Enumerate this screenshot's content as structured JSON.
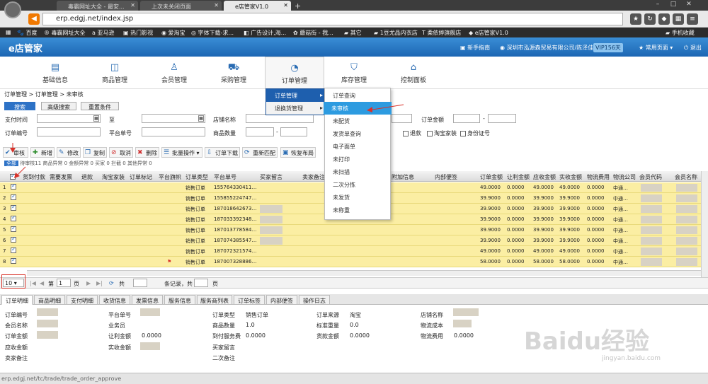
{
  "browser": {
    "tabs": [
      "毒霸网址大全 - 最安...",
      "上次未关闭页面",
      "e店管家V1.0"
    ],
    "new_tab": "+",
    "url": "erp.edgj.net/index.jsp"
  },
  "bookmarks": [
    "百度",
    "毒霸网址大全",
    "亚马逊",
    "热门影视",
    "爱淘宝",
    "字体下载-求...",
    "广告设计,海...",
    "蘑菇街 - 我...",
    "其它",
    "1豆尤品内衣店",
    "柔依婷旗舰店",
    "e店管家V1.0",
    "手机收藏"
  ],
  "app": {
    "logo": "e店管家",
    "header_links": [
      "新手指南",
      "深圳市泓源森贸易有限公司/陈泽佳",
      "VIP156天",
      "常用页面",
      "退出"
    ]
  },
  "menu": [
    {
      "label": "基础信息",
      "icon": "info-icon"
    },
    {
      "label": "商品管理",
      "icon": "bag-icon"
    },
    {
      "label": "会员管理",
      "icon": "user-icon"
    },
    {
      "label": "采购管理",
      "icon": "truck-icon"
    },
    {
      "label": "订单管理",
      "icon": "pie-icon"
    },
    {
      "label": "库存管理",
      "icon": "cart-icon"
    },
    {
      "label": "控制面板",
      "icon": "home-icon"
    }
  ],
  "breadcrumb": "订单管理 > 订单管理 > 未审核",
  "search_tabs": [
    "搜索",
    "高级搜索",
    "重置条件"
  ],
  "filters": {
    "pay_time": "支付时间",
    "to": "至",
    "shop_name": "店铺名称",
    "order_amount": "订单金额",
    "order_no": "订单编号",
    "platform_no": "平台单号",
    "goods_qty": "商品数量",
    "dash": "-",
    "cb_labels": [
      "退款",
      "淘宝家装",
      "身份证号"
    ]
  },
  "toolbar": [
    "审核",
    "新增",
    "修改",
    "复制",
    "取消",
    "删除",
    "批量操作",
    "订单下载",
    "重新匹配",
    "恢复布局"
  ],
  "status_row": {
    "all": "全部",
    "text": "待审核11  商品异常 0  金额异常 0  买家 0  拦截 0  其他异常 0"
  },
  "columns": [
    "货到付款",
    "需要发票",
    "退款",
    "淘宝家装",
    "订单标记",
    "平台旗帜",
    "订单类型",
    "平台单号",
    "买家留言",
    "卖家备注",
    "附加信息",
    "内部便签",
    "订单金额",
    "让利金额",
    "应收金额",
    "实收金额",
    "物流费用",
    "物流公司",
    "会员代码",
    "会员名称"
  ],
  "rows": [
    {
      "n": "1",
      "type": "销售订单",
      "no": "155764330411…",
      "amt": "49.0000",
      "disc": "0.0000",
      "recv": "49.0000",
      "paid": "49.0000",
      "ship": "0.0000",
      "logi": "中通…",
      "flag": false
    },
    {
      "n": "2",
      "type": "销售订单",
      "no": "155855224747…",
      "amt": "39.9000",
      "disc": "0.0000",
      "recv": "39.9000",
      "paid": "39.9000",
      "ship": "0.0000",
      "logi": "中通…",
      "flag": false
    },
    {
      "n": "3",
      "type": "销售订单",
      "no": "187018642673…",
      "amt": "39.9000",
      "disc": "0.0000",
      "recv": "39.9000",
      "paid": "39.9000",
      "ship": "0.0000",
      "logi": "中通…",
      "flag": false
    },
    {
      "n": "4",
      "type": "销售订单",
      "no": "187033392348…",
      "amt": "39.9000",
      "disc": "0.0000",
      "recv": "39.9000",
      "paid": "39.9000",
      "ship": "0.0000",
      "logi": "中通…",
      "flag": false
    },
    {
      "n": "5",
      "type": "销售订单",
      "no": "187013778584…",
      "amt": "39.9000",
      "disc": "0.0000",
      "recv": "39.9000",
      "paid": "39.9000",
      "ship": "0.0000",
      "logi": "中通…",
      "flag": false
    },
    {
      "n": "6",
      "type": "销售订单",
      "no": "187074385547…",
      "amt": "39.9000",
      "disc": "0.0000",
      "recv": "39.9000",
      "paid": "39.9000",
      "ship": "0.0000",
      "logi": "中通…",
      "flag": false
    },
    {
      "n": "7",
      "type": "销售订单",
      "no": "187072321574…",
      "amt": "49.0000",
      "disc": "0.0000",
      "recv": "49.0000",
      "paid": "49.0000",
      "ship": "0.0000",
      "logi": "中通…",
      "flag": false
    },
    {
      "n": "8",
      "type": "销售订单",
      "no": "187007328886…",
      "amt": "58.0000",
      "disc": "0.0000",
      "recv": "58.0000",
      "paid": "58.0000",
      "ship": "0.0000",
      "logi": "中通…",
      "flag": true
    }
  ],
  "pager": {
    "page_size": "10",
    "page_label": "第",
    "page": "1",
    "page_unit": "页",
    "total_prefix": "共",
    "records": "条记录，共",
    "pages_unit": "页"
  },
  "detail_tabs": [
    "订单明细",
    "商品明细",
    "支付明细",
    "收货信息",
    "发票信息",
    "服务信息",
    "服务商列表",
    "订单标签",
    "内部便签",
    "操作日志"
  ],
  "detail": {
    "col1": [
      "订单编号",
      "会员名称",
      "订单金额",
      "应收金额",
      "卖家备注"
    ],
    "col2": [
      "平台单号",
      "业务员",
      "让利金额",
      "实收金额"
    ],
    "col2_vals": [
      "",
      "",
      "0.0000",
      ""
    ],
    "col3": [
      "订单类型",
      "商品数量",
      "到付服务费",
      "买家留言",
      "二次备注"
    ],
    "col3_vals": [
      "销售订单",
      "1.0",
      "0.0000",
      "",
      ""
    ],
    "col4": [
      "订单来源",
      "标准重量",
      "货款金额"
    ],
    "col4_vals": [
      "淘宝",
      "0.0",
      "0.0000"
    ],
    "col5": [
      "店铺名称",
      "物流成本",
      "物流费用"
    ],
    "col5_vals": [
      "",
      "",
      "0.0000"
    ]
  },
  "dropdown1": [
    "订单管理",
    "退换货管理"
  ],
  "dropdown2": [
    "订单查询",
    "未审核",
    "未配货",
    "发货单查询",
    "电子面单",
    "未打印",
    "未扫描",
    "二次分拣",
    "未发货",
    "未称重"
  ],
  "status_url": "erp.edgj.net/tc/trade/trade_order_approve",
  "watermark": "Baidu经验",
  "watermark2": "jingyan.baidu.com"
}
